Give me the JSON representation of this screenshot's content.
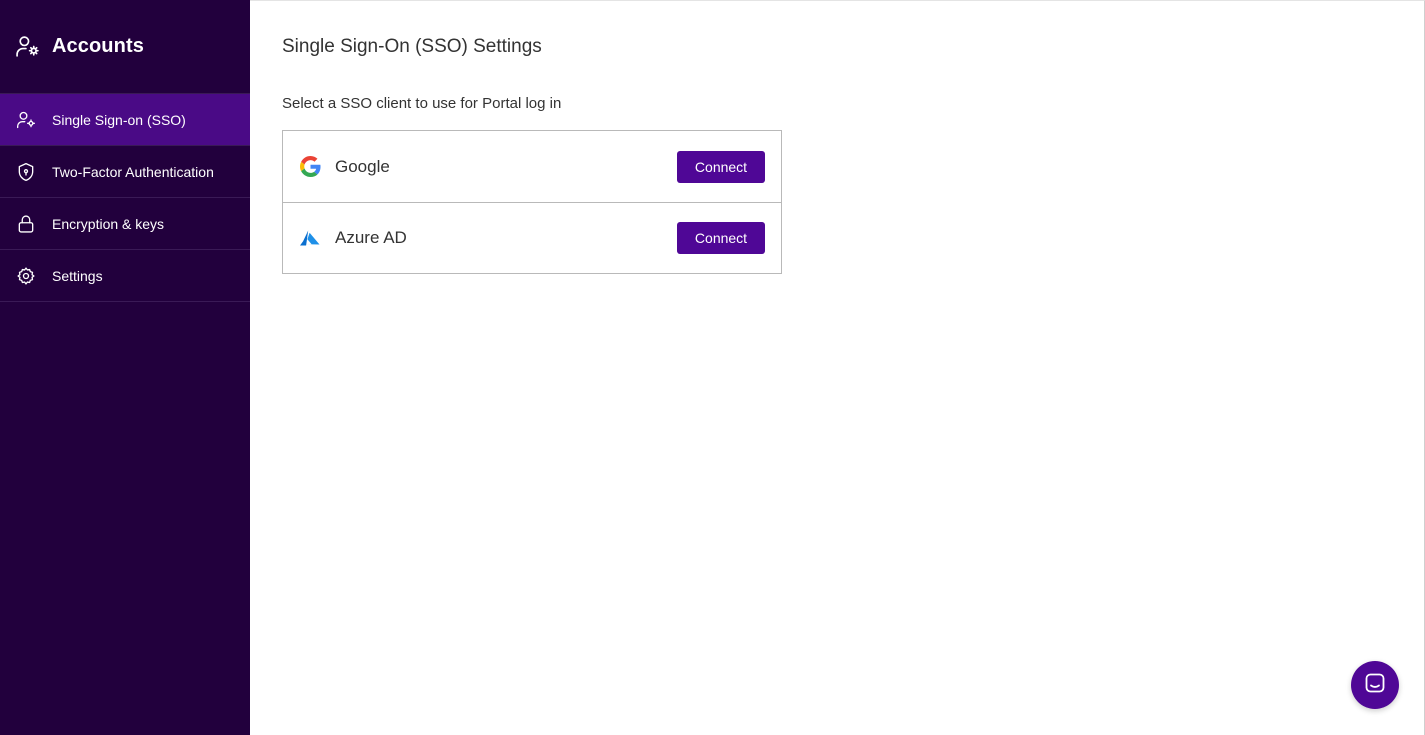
{
  "sidebar": {
    "title": "Accounts",
    "title_icon": "user-gear-icon",
    "items": [
      {
        "label": "Single Sign-on (SSO)",
        "icon": "user-gear-icon",
        "active": true
      },
      {
        "label": "Two-Factor Authentication",
        "icon": "shield-icon",
        "active": false
      },
      {
        "label": "Encryption & keys",
        "icon": "lock-icon",
        "active": false
      },
      {
        "label": "Settings",
        "icon": "gear-icon",
        "active": false
      }
    ]
  },
  "main": {
    "title": "Single Sign-On (SSO) Settings",
    "subtitle": "Select a SSO client to use for Portal log in",
    "providers": [
      {
        "name": "Google",
        "icon": "google-logo-icon",
        "button_label": "Connect"
      },
      {
        "name": "Azure AD",
        "icon": "azure-logo-icon",
        "button_label": "Connect"
      }
    ]
  },
  "chat": {
    "icon": "chat-icon"
  },
  "colors": {
    "sidebar_bg": "#22003d",
    "sidebar_active": "#4a0a86",
    "accent": "#4f0796"
  }
}
